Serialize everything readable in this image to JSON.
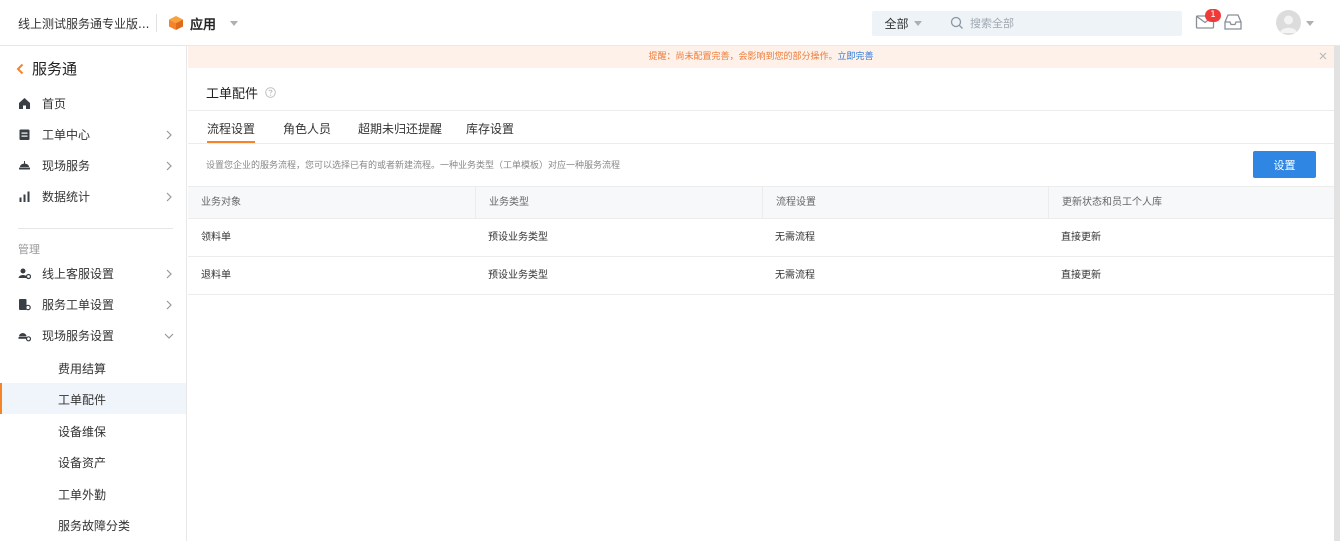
{
  "header": {
    "company": "线上测试服务通专业版...",
    "app_label": "应用",
    "search": {
      "scope": "全部",
      "placeholder": "搜索全部"
    },
    "mail_badge": "1"
  },
  "sidebar": {
    "title": "服务通",
    "items": [
      {
        "label": "首页",
        "icon": "home-icon"
      },
      {
        "label": "工单中心",
        "icon": "clipboard-icon"
      },
      {
        "label": "现场服务",
        "icon": "helmet-icon"
      },
      {
        "label": "数据统计",
        "icon": "bar-chart-icon"
      }
    ],
    "section_label": "管理",
    "manage_items": [
      {
        "label": "线上客服设置",
        "icon": "user-gear-icon"
      },
      {
        "label": "服务工单设置",
        "icon": "doc-gear-icon"
      },
      {
        "label": "现场服务设置",
        "icon": "helmet-gear-icon"
      }
    ],
    "sub_items": [
      {
        "label": "费用结算"
      },
      {
        "label": "工单配件"
      },
      {
        "label": "设备维保"
      },
      {
        "label": "设备资产"
      },
      {
        "label": "工单外勤"
      },
      {
        "label": "服务故障分类"
      }
    ],
    "active_sub": "工单配件"
  },
  "notice": {
    "text": "提醒：尚未配置完善，会影响到您的部分操作。",
    "link": "立即完善"
  },
  "page": {
    "title": "工单配件",
    "tabs": [
      {
        "label": "流程设置"
      },
      {
        "label": "角色人员"
      },
      {
        "label": "超期未归还提醒"
      },
      {
        "label": "库存设置"
      }
    ],
    "active_tab": "流程设置",
    "description": "设置您企业的服务流程，您可以选择已有的或者新建流程。一种业务类型（工单模板）对应一种服务流程",
    "set_button": "设置"
  },
  "table": {
    "columns": [
      "业务对象",
      "业务类型",
      "流程设置",
      "更新状态和员工个人库"
    ],
    "rows": [
      [
        "领料单",
        "预设业务类型",
        "无需流程",
        "直接更新"
      ],
      [
        "退料单",
        "预设业务类型",
        "无需流程",
        "直接更新"
      ]
    ]
  },
  "colors": {
    "accent": "#f5832a",
    "primary": "#2f86e3",
    "badge": "#f03a3a",
    "notice_bg": "#fdf1ea",
    "notice_text": "#f07a36"
  }
}
